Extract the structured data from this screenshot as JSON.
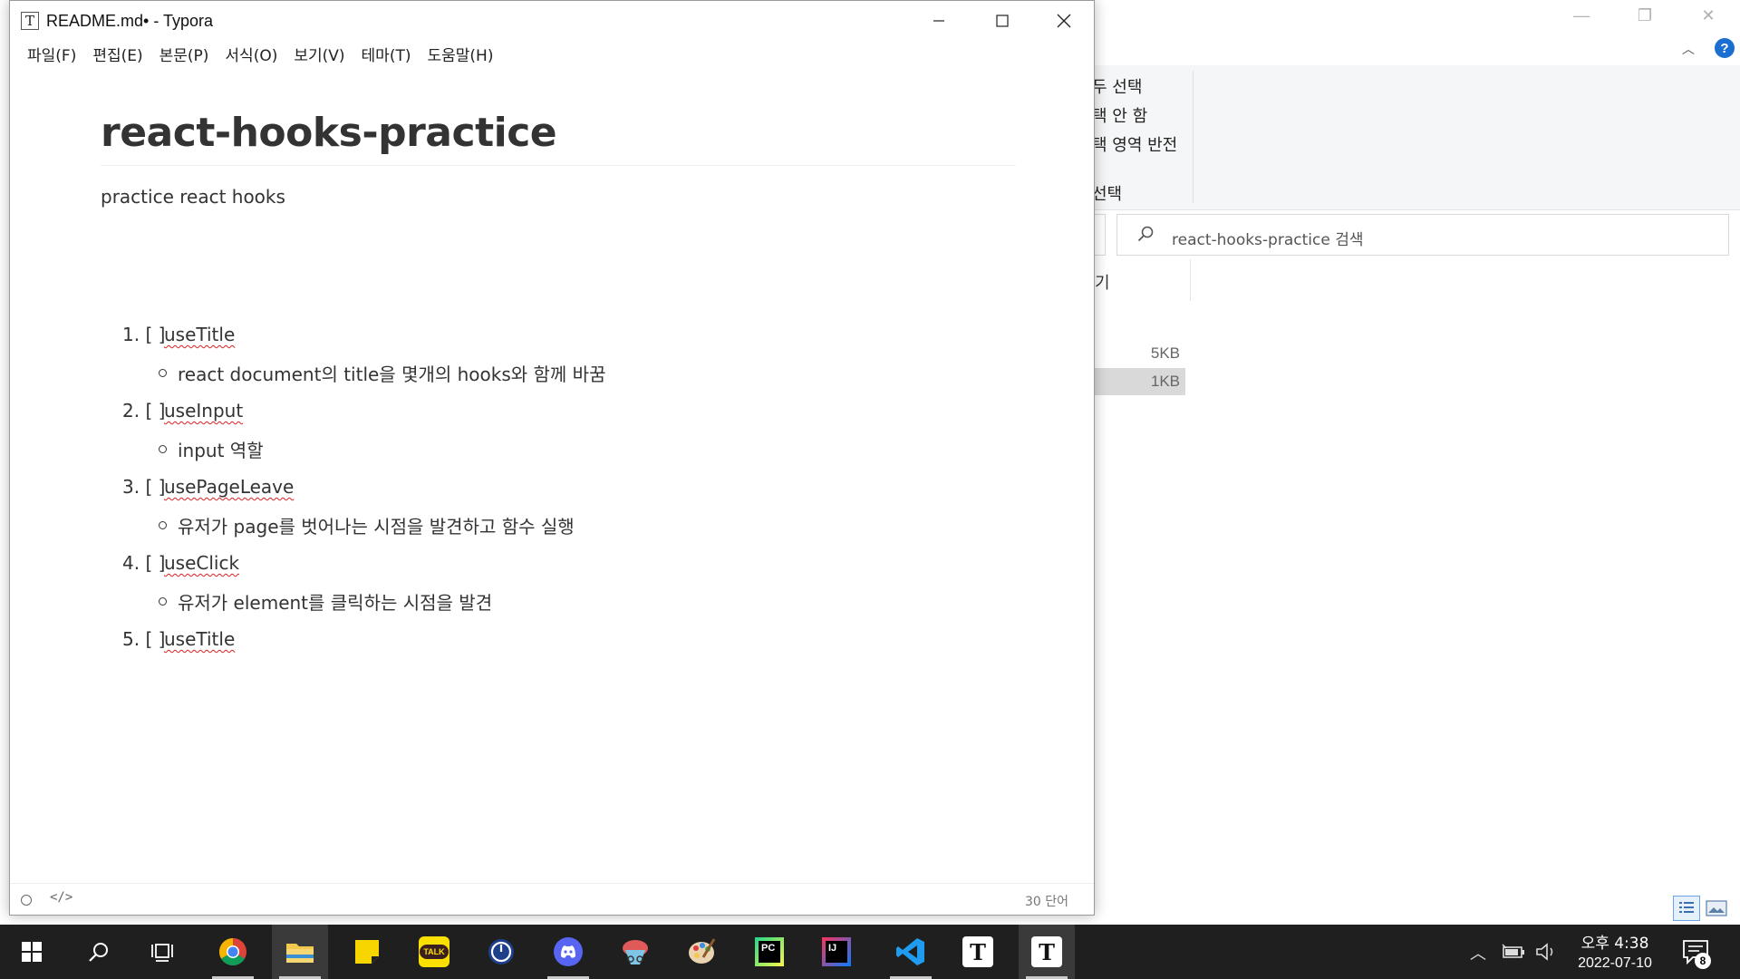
{
  "explorer": {
    "ribbon_items": [
      "두 선택",
      "택 안 함",
      "택 영역 반전",
      "선택"
    ],
    "search_placeholder": "react-hooks-practice 검색",
    "column_partial": "기",
    "sizes": [
      "5KB",
      "1KB"
    ]
  },
  "typora": {
    "title": "README.md• - Typora",
    "menu": [
      "파일(F)",
      "편집(E)",
      "본문(P)",
      "서식(O)",
      "보기(V)",
      "테마(T)",
      "도움말(H)"
    ],
    "heading": "react-hooks-practice",
    "paragraph": "practice react hooks",
    "list": [
      {
        "num": "1.",
        "checkbox": "[ ]",
        "name": "useTitle",
        "desc": "react document의 title을 몇개의 hooks와 함께 바꿈"
      },
      {
        "num": "2.",
        "checkbox": "[ ]",
        "name": "useInput",
        "desc": "input 역할"
      },
      {
        "num": "3.",
        "checkbox": "[ ]",
        "name": "usePageLeave",
        "desc": "유저가 page를 벗어나는 시점을 발견하고 함수 실행"
      },
      {
        "num": "4.",
        "checkbox": "[ ]",
        "name": "useClick",
        "desc": "유저가 element를 클릭하는 시점을 발견"
      },
      {
        "num": "5.",
        "checkbox": "[ ]",
        "name": "useTitle",
        "desc": ""
      }
    ],
    "status_code_icon": "</>",
    "word_count": "30 단어"
  },
  "taskbar": {
    "apps": [
      "windows-start-icon",
      "search-icon",
      "task-view-icon",
      "chrome-icon",
      "file-explorer-icon",
      "sticky-notes-icon",
      "kakaotalk-icon",
      "clock-app-icon",
      "discord-icon",
      "snipping-tool-icon",
      "paint-icon",
      "pycharm-icon",
      "intellij-icon",
      "vscode-icon",
      "typora-icon",
      "typora-icon"
    ],
    "kakao_label": "TALK",
    "pycharm_label": "PC",
    "intellij_label": "IJ",
    "typora_label": "T",
    "time": "오후 4:38",
    "date": "2022-07-10",
    "notification_count": "8"
  }
}
